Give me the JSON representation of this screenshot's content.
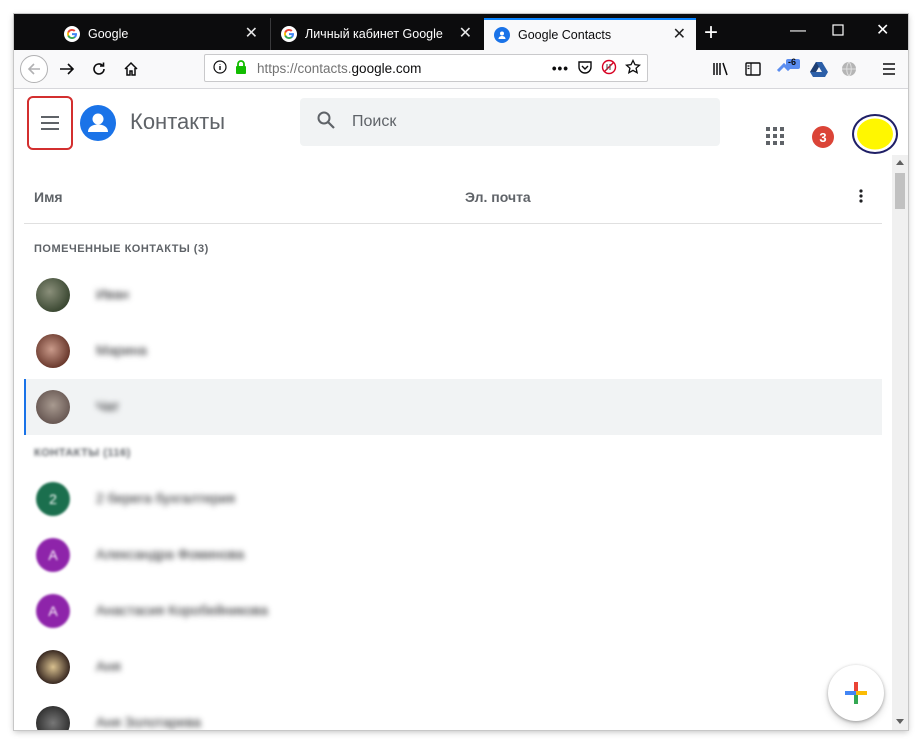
{
  "browser": {
    "tabs": [
      {
        "title": "Google"
      },
      {
        "title": "Личный кабинет Google"
      },
      {
        "title": "Google Contacts"
      }
    ],
    "url": {
      "scheme": "https://contacts.",
      "host": "google.com"
    },
    "extension_badge": "-6"
  },
  "app": {
    "title": "Контакты",
    "search_placeholder": "Поиск",
    "notification_count": "3",
    "colors": {
      "accent": "#1a73e8",
      "highlight": "#d32f2f",
      "avatar": "#fff700",
      "badge": "#db4437"
    }
  },
  "table": {
    "col_name": "Имя",
    "col_email": "Эл. почта"
  },
  "starred": {
    "label": "ПОМЕЧЕННЫЕ КОНТАКТЫ (3)",
    "rows": [
      {
        "name": "Иван"
      },
      {
        "name": "Марина"
      },
      {
        "name": "Чат"
      }
    ]
  },
  "contacts": {
    "label": "КОНТАКТЫ (116)",
    "rows": [
      {
        "name": "2 берега бухгалтерия",
        "initial": "2"
      },
      {
        "name": "Александра Фоминова",
        "initial": "А"
      },
      {
        "name": "Анастасия Коробейникова",
        "initial": "А"
      },
      {
        "name": "Аня"
      },
      {
        "name": "Аня Золотарева"
      }
    ]
  }
}
